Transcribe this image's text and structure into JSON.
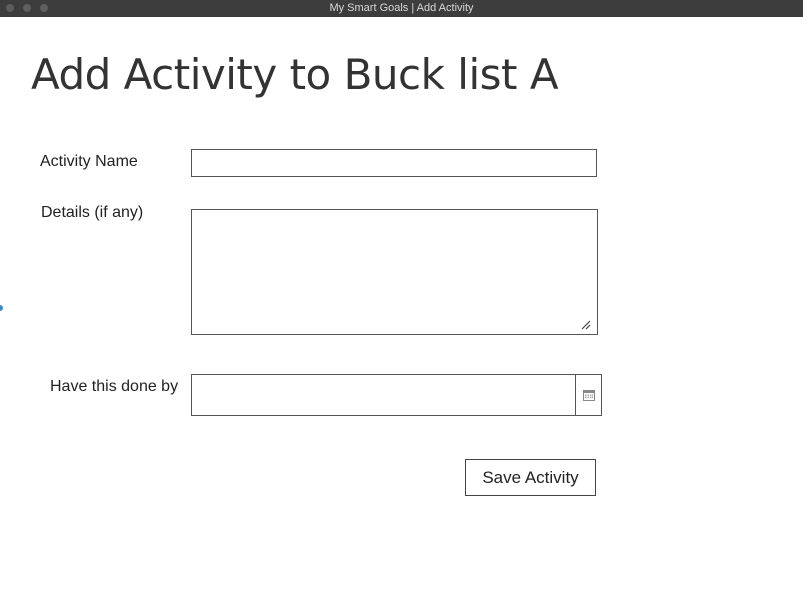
{
  "window": {
    "title": "My Smart Goals | Add Activity"
  },
  "page": {
    "title": "Add Activity to Buck list A"
  },
  "form": {
    "activity_name": {
      "label": "Activity Name",
      "value": "",
      "placeholder": ""
    },
    "details": {
      "label": "Details (if any)",
      "value": "",
      "placeholder": ""
    },
    "due_date": {
      "label": "Have this done by",
      "value": "",
      "placeholder": ""
    },
    "save_label": "Save Activity"
  },
  "icons": {
    "calendar": "calendar-icon",
    "resize": "resize-grip-icon"
  }
}
